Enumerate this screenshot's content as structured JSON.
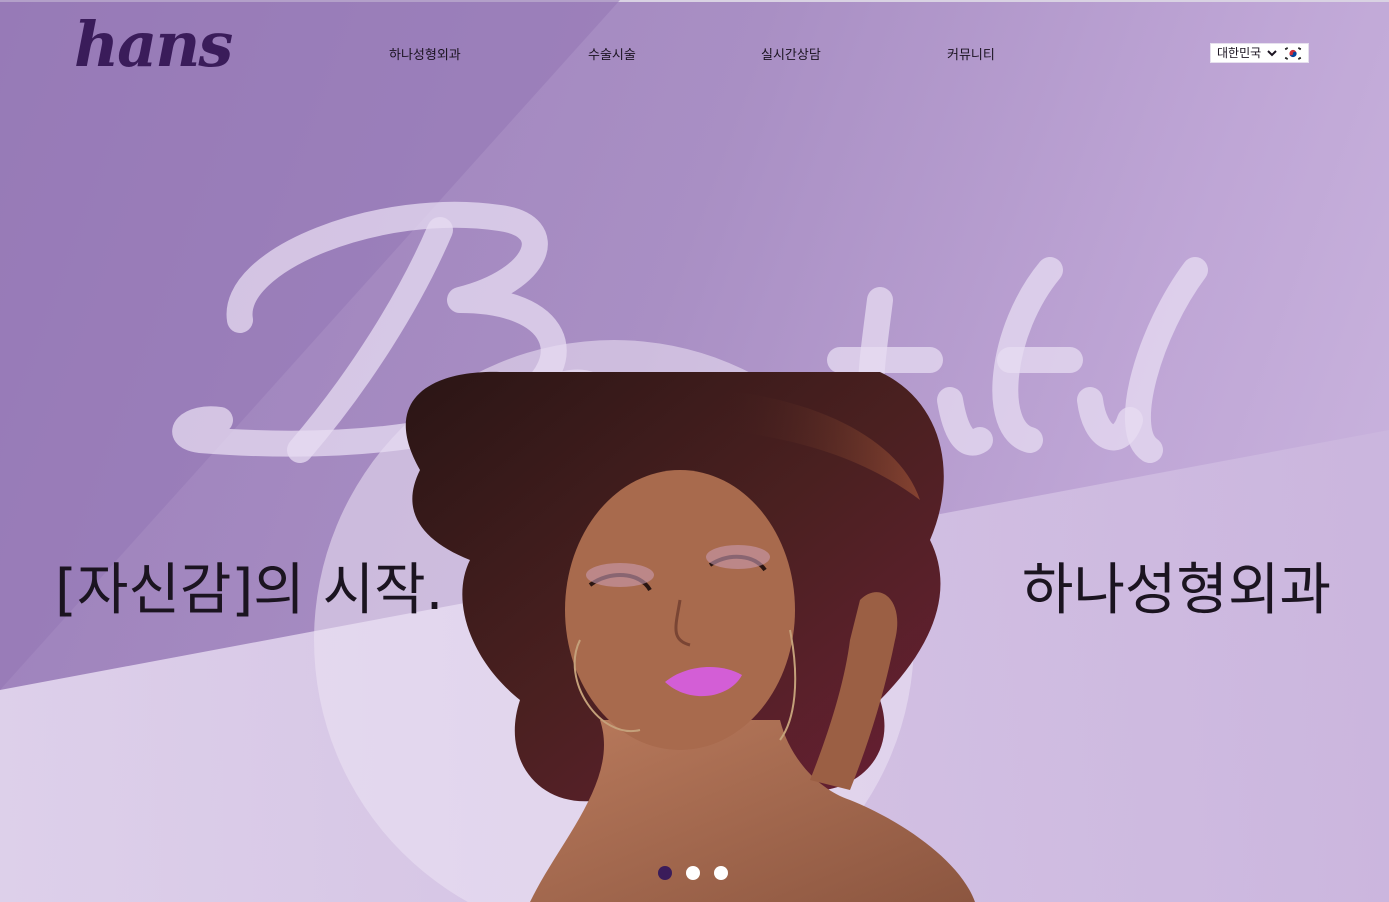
{
  "header": {
    "logo_text": "hans",
    "nav": [
      {
        "label": "하나성형외과"
      },
      {
        "label": "수술시술"
      },
      {
        "label": "실시간상담"
      },
      {
        "label": "커뮤니티"
      }
    ],
    "language": {
      "selected": "대한민국",
      "options": [
        "대한민국"
      ],
      "flag_icon": "korea-flag-icon"
    }
  },
  "hero": {
    "script_word": "Beautiful",
    "headline_left": "[자신감]의 시작.",
    "headline_right": "하나성형외과",
    "image_subject": "woman with curly hair and pink lipstick",
    "slides_total": 3,
    "active_slide": 1
  },
  "colors": {
    "bg_purple": "#a98fc4",
    "logo_purple": "#3a1c5a",
    "text_dark": "#1b1420",
    "lipstick": "#d35ed6",
    "dot_active": "#3a1c5a",
    "dot_inactive": "#ffffff"
  }
}
